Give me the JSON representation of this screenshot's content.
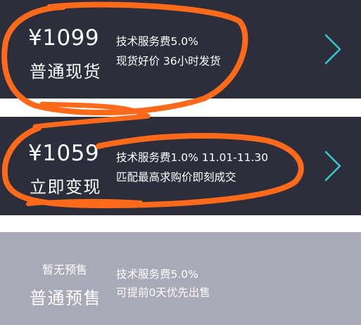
{
  "options": [
    {
      "price": "¥1099",
      "title": "普通现货",
      "fee": "技术服务费5.0%",
      "desc": "现货好价 36小时发货"
    },
    {
      "price": "¥1059",
      "title": "立即变现",
      "fee": "技术服务费1.0% 11.01-11.30",
      "desc": "匹配最高求购价即刻成交"
    },
    {
      "status": "暂无预售",
      "title": "普通预售",
      "fee": "技术服务费5.0%",
      "desc": "可提前0天优先出售"
    }
  ],
  "icons": {
    "chevron": "chevron-right-icon",
    "badge": "red-dot"
  },
  "colors": {
    "card_dark": "#2d2e3c",
    "card_disabled": "#a9a9b8",
    "chevron": "#35c8cf",
    "annotation": "#ff6a1a",
    "badge": "#ff3b5c"
  }
}
